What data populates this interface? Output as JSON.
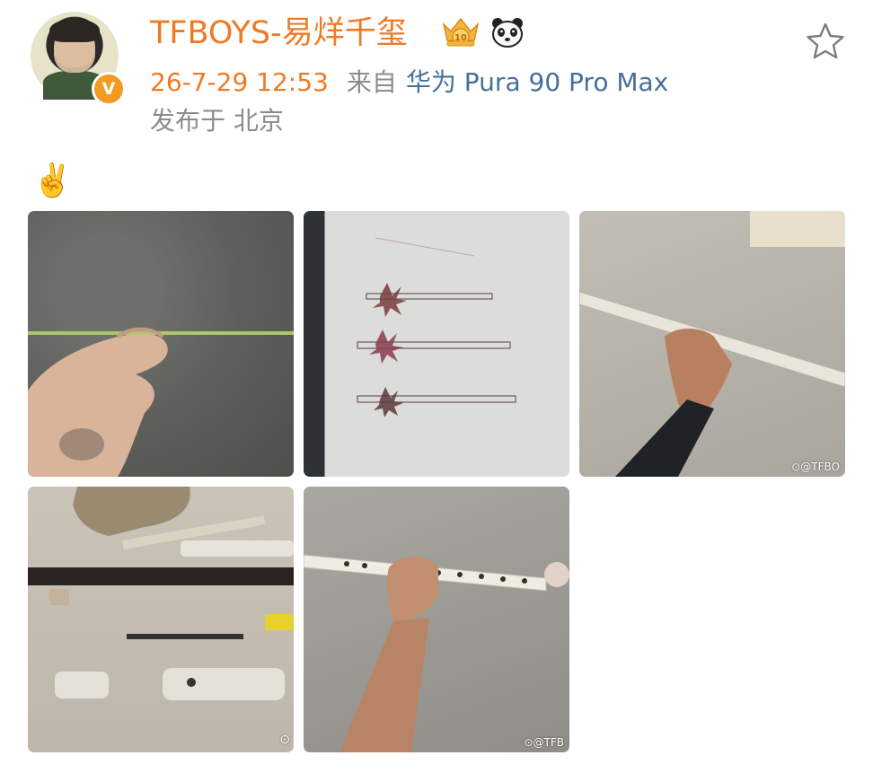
{
  "post": {
    "author": {
      "name": "TFBOYS-易烊千玺",
      "verified_badge_glyph": "V",
      "level_badge_text": "10"
    },
    "time": "26-7-29 12:53",
    "from_label": "来自",
    "device": "华为 Pura 90 Pro Max",
    "location": "发布于 北京",
    "text": "✌️",
    "watermarks": {
      "photo3": "@TFBO",
      "photo5": "@TFB"
    }
  },
  "colors": {
    "username": "#f07a24",
    "time": "#f07a24",
    "device_link": "#466f9a",
    "muted": "#8c8c8c",
    "verified": "#f29a22"
  },
  "icons": {
    "favorite": "star-outline-icon",
    "level": "crown-level-badge-icon",
    "panda": "panda-icon",
    "verified": "verified-v-icon"
  }
}
